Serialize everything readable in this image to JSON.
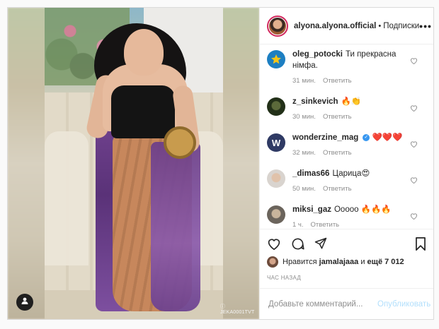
{
  "header": {
    "username": "alyona.alyona.official",
    "follow_label": "Подписки",
    "more_label": "•••"
  },
  "media": {
    "watermark": "ⓘ JEKA0001TVT"
  },
  "comments": [
    {
      "user": "oleg_potocki",
      "text": "Ти прекрасна німфа.",
      "time": "31 мин.",
      "reply": "Ответить",
      "avatar_color": "#1d7fc2"
    },
    {
      "user": "z_sinkevich",
      "text": "🔥👏",
      "time": "30 мин.",
      "reply": "Ответить",
      "avatar_color": "#223018"
    },
    {
      "user": "wonderzine_mag",
      "verified": true,
      "text": "❤️❤️❤️",
      "time": "32 мин.",
      "reply": "Ответить",
      "avatar_color": "#2f3a64"
    },
    {
      "user": "_dimas66",
      "text": "Царица😍",
      "time": "50 мин.",
      "reply": "Ответить",
      "avatar_color": "#d9d4cf"
    },
    {
      "user": "miksi_gaz",
      "text": "Ооооо 🔥🔥🔥",
      "time": "1 ч.",
      "reply": "Ответить",
      "avatar_color": "#6b645c"
    }
  ],
  "likes": {
    "prefix": "Нравится",
    "user": "jamalajaaa",
    "middle": "и",
    "count": "ещё 7 012"
  },
  "timestamp": "ЧАС НАЗАД",
  "add_comment": {
    "placeholder": "Добавьте комментарий...",
    "publish_label": "Опубликовать"
  },
  "colors": {
    "accent_blue": "#3897f0",
    "publish_disabled": "#b2dffc",
    "border": "#dbdbdb"
  }
}
